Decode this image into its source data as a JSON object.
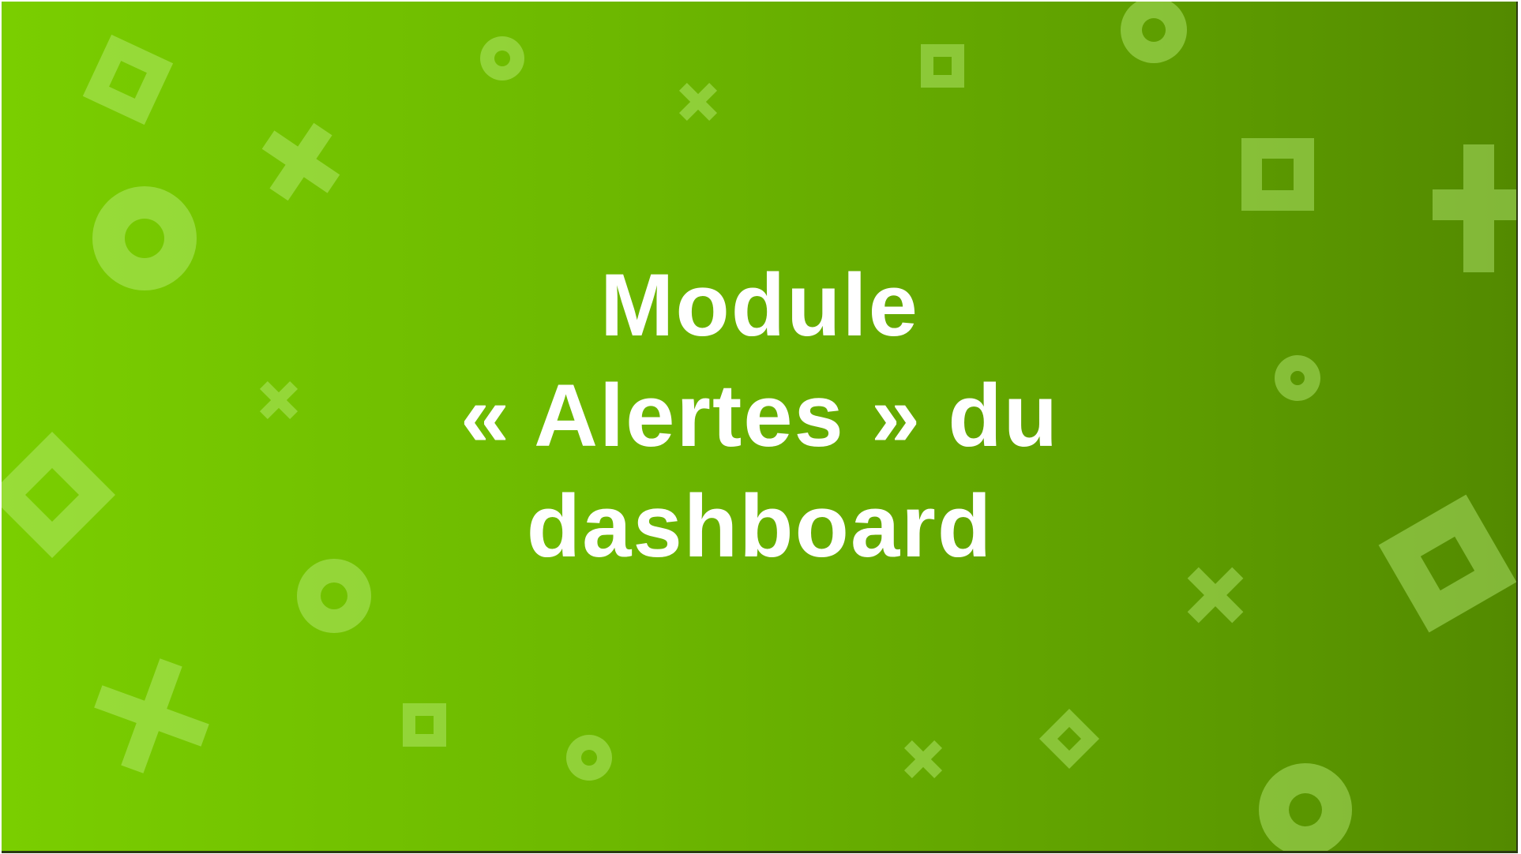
{
  "slide": {
    "title_lines": [
      "Module",
      "« Alertes » du",
      "dashboard"
    ]
  },
  "colors": {
    "background_start": "#7ace00",
    "background_end": "#538a00",
    "title_text": "#ffffff",
    "shape_fill": "#a9de6e"
  },
  "decorations": {
    "shape_icons": [
      "circle-ring-icon",
      "square-ring-icon",
      "diamond-ring-icon",
      "cross-icon",
      "plus-icon"
    ]
  }
}
